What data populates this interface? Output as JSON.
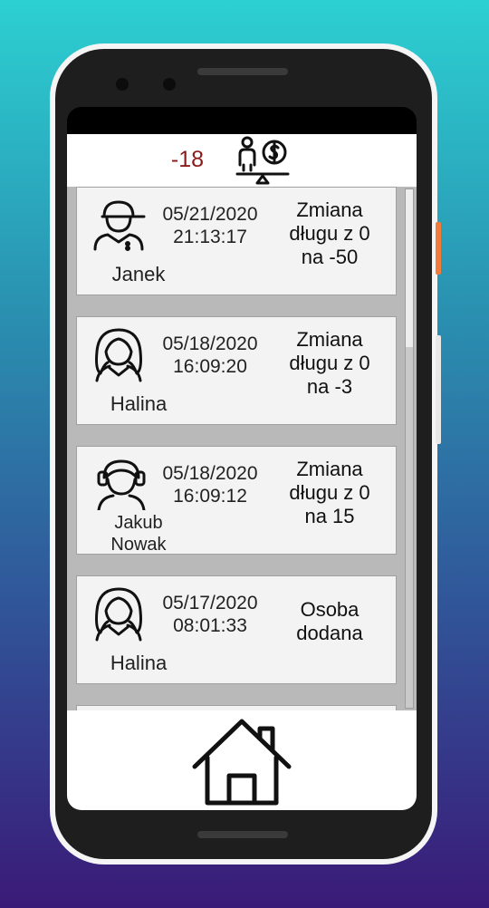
{
  "header": {
    "balance": "-18",
    "icon": "debt-balance-icon"
  },
  "entries": [
    {
      "date": "05/21/2020",
      "time": "21:13:17",
      "name": "Janek",
      "description": "Zmiana\ndługu z 0\nna -50",
      "avatar": "boy-cap-avatar-icon"
    },
    {
      "date": "05/18/2020",
      "time": "16:09:20",
      "name": "Halina",
      "description": "Zmiana\ndługu z 0\nna -3",
      "avatar": "woman-avatar-icon"
    },
    {
      "date": "05/18/2020",
      "time": "16:09:12",
      "name": "Jakub\nNowak",
      "description": "Zmiana\ndługu z 0\nna 15",
      "avatar": "headphones-avatar-icon"
    },
    {
      "date": "05/17/2020",
      "time": "08:01:33",
      "name": "Halina",
      "description": "Osoba\ndodana",
      "avatar": "woman-avatar-icon"
    }
  ],
  "footer": {
    "icon": "home-icon"
  }
}
